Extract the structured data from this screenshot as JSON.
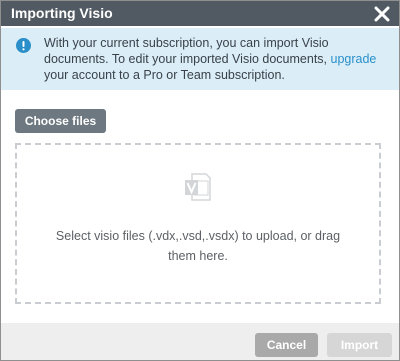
{
  "dialog": {
    "title": "Importing Visio",
    "close_icon": "close-icon"
  },
  "notice": {
    "icon": "info-icon",
    "text_before": "With your current subscription, you can import Visio documents. To edit your imported Visio documents, ",
    "link_text": "upgrade",
    "text_after": " your account to a Pro or Team subscription."
  },
  "upload": {
    "choose_label": "Choose files",
    "icon": "visio-file-icon",
    "drop_text": "Select visio files (.vdx,.vsd,.vsdx) to upload, or drag them here."
  },
  "footer": {
    "cancel_label": "Cancel",
    "import_label": "Import"
  },
  "colors": {
    "titlebar": "#515a63",
    "notice_bg": "#dbeef8",
    "accent_blue": "#2a8fc9",
    "footer_bg": "#eeeeee"
  }
}
